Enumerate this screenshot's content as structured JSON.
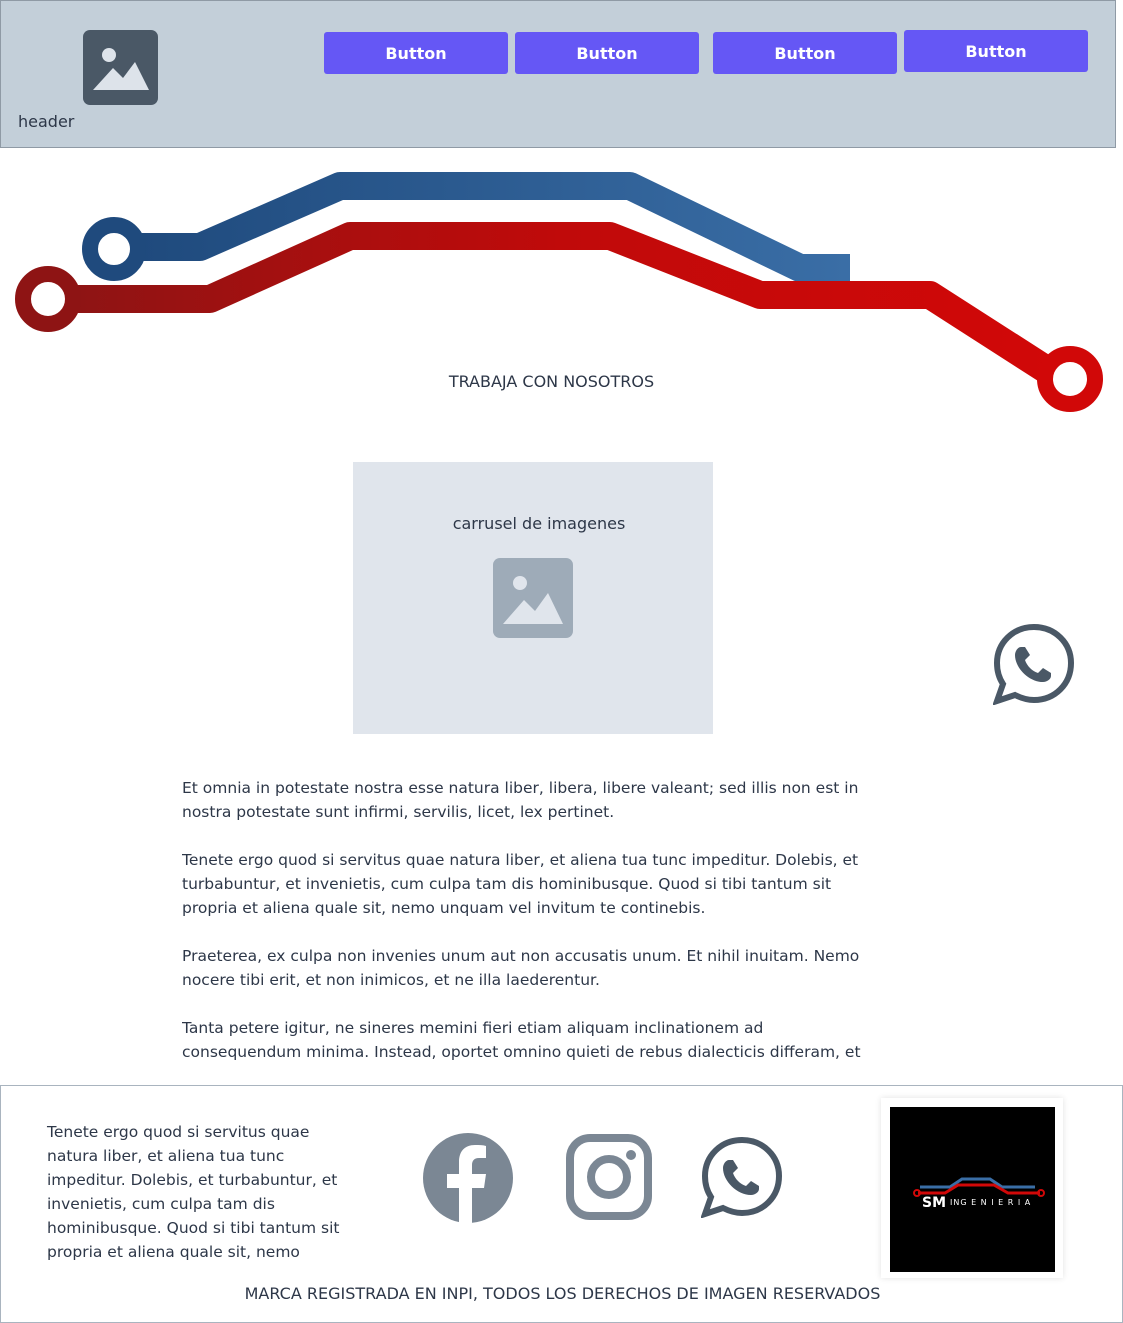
{
  "header": {
    "label": "header",
    "logo_icon": "image-placeholder-icon",
    "nav_buttons": [
      "Button",
      "Button",
      "Button",
      "Button"
    ]
  },
  "colors": {
    "header_bg": "#c3cfd9",
    "button_bg": "#6557f5",
    "circuit_blue": "#2b5a8e",
    "circuit_red": "#c00a0a",
    "placeholder_bg": "#e0e5ec",
    "icon_gray": "#7b8794"
  },
  "section": {
    "title": "TRABAJA CON NOSOTROS"
  },
  "carousel": {
    "label": "carrusel de imagenes",
    "icon": "image-placeholder-icon"
  },
  "floating": {
    "icon": "whatsapp-icon"
  },
  "content": {
    "paragraphs": [
      "Et omnia in potestate nostra esse natura liber, libera, libere valeant; sed illis non est in nostra potestate sunt infirmi, servilis, licet, lex pertinet.",
      "Tenete ergo quod si servitus quae natura liber, et aliena tua tunc impeditur. Dolebis, et turbabuntur, et invenietis, cum culpa tam dis hominibusque. Quod si tibi tantum sit propria et aliena quale sit, nemo unquam vel invitum te continebis.",
      "Praeterea, ex culpa non invenies unum aut non accusatis unum. Et nihil inuitam. Nemo nocere tibi erit, et non inimicos, et ne illa laederentur.",
      "Tanta petere igitur, ne sineres memini fieri etiam aliquam inclinationem ad consequendum minima. Instead, oportet omnino quieti de rebus dialecticis differam, et"
    ]
  },
  "footer": {
    "text": "Tenete ergo quod si servitus quae natura liber, et aliena tua tunc impeditur. Dolebis, et turbabuntur, et invenietis, cum culpa tam dis hominibusque. Quod si tibi tantum sit propria et aliena quale sit, nemo",
    "social_icons": [
      "facebook-icon",
      "instagram-icon",
      "whatsapp-icon"
    ],
    "brand_text": "ING E N I E R I A",
    "brand_mark": "SM",
    "legal": "MARCA REGISTRADA EN INPI, TODOS LOS DERECHOS DE IMAGEN RESERVADOS"
  }
}
